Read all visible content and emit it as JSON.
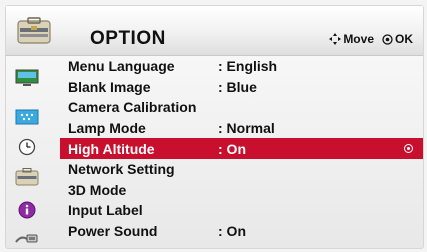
{
  "header": {
    "title": "OPTION",
    "icon": "toolbox-icon",
    "hints": [
      {
        "icon": "four-way-arrow-icon",
        "label": "Move"
      },
      {
        "icon": "ok-circle-icon",
        "label": "OK"
      }
    ]
  },
  "sidebar": {
    "icons": [
      "monitor-icon",
      "screen-icon",
      "clock-icon",
      "toolbox-icon",
      "info-icon",
      "cable-icon"
    ]
  },
  "menu": {
    "items": [
      {
        "label": "Menu Language",
        "value": ": English"
      },
      {
        "label": "Blank Image",
        "value": ": Blue"
      },
      {
        "label": "Camera Calibration",
        "value": ""
      },
      {
        "label": "Lamp Mode",
        "value": ": Normal"
      },
      {
        "label": "High Altitude",
        "value": ": On",
        "selected": true
      },
      {
        "label": "Network Setting",
        "value": ""
      },
      {
        "label": "3D Mode",
        "value": ""
      },
      {
        "label": "Input Label",
        "value": ""
      },
      {
        "label": "Power Sound",
        "value": ": On"
      }
    ]
  },
  "colors": {
    "selected_bg": "#c8102e",
    "panel_bg": "#f0f0f0"
  }
}
